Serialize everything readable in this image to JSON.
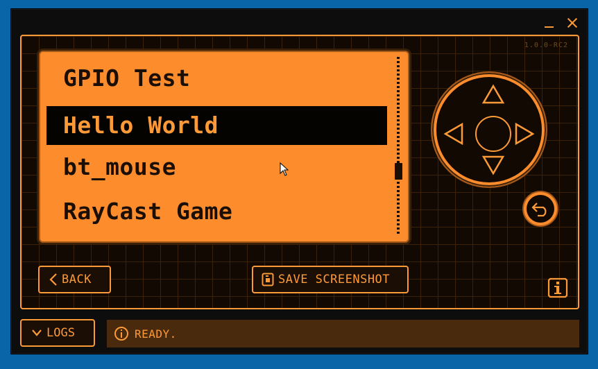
{
  "window": {
    "minimize_icon": "minimize-icon",
    "close_icon": "close-icon"
  },
  "device": {
    "version": "1.0.0-RC2"
  },
  "menu": {
    "items": [
      {
        "label": "GPIO Test",
        "selected": false
      },
      {
        "label": "Hello World",
        "selected": true
      },
      {
        "label": "bt_mouse",
        "selected": false
      },
      {
        "label": "RayCast Game",
        "selected": false
      }
    ]
  },
  "buttons": {
    "back_label": "BACK",
    "save_screenshot_label": "SAVE SCREENSHOT",
    "logs_label": "LOGS"
  },
  "status": {
    "text": "READY."
  },
  "colors": {
    "accent": "#fd9a38",
    "screen": "#fd8c2d",
    "background": "#0a64a8"
  }
}
